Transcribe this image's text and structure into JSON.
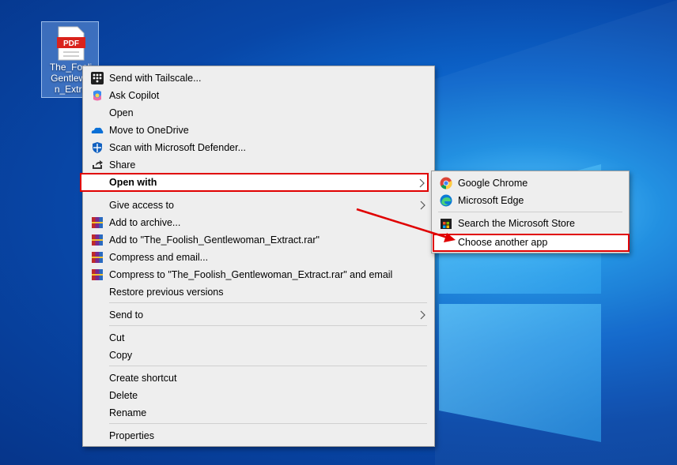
{
  "desktop": {
    "file": {
      "name_lines": [
        "The_Fooli",
        "Gentlewo",
        "n_Extra"
      ],
      "badge": "PDF"
    }
  },
  "context_menu": {
    "items": [
      {
        "label": "Send with Tailscale...",
        "icon": "tailscale-icon"
      },
      {
        "label": "Ask Copilot",
        "icon": "copilot-icon"
      },
      {
        "label": "Open"
      },
      {
        "label": "Move to OneDrive",
        "icon": "onedrive-icon"
      },
      {
        "label": "Scan with Microsoft Defender...",
        "icon": "defender-icon"
      },
      {
        "label": "Share",
        "icon": "share-icon"
      },
      {
        "label": "Open with",
        "submenu": true
      },
      {
        "label": "Give access to",
        "submenu": true
      },
      {
        "label": "Add to archive...",
        "icon": "winrar-icon"
      },
      {
        "label": "Add to \"The_Foolish_Gentlewoman_Extract.rar\"",
        "icon": "winrar-icon"
      },
      {
        "label": "Compress and email...",
        "icon": "winrar-icon"
      },
      {
        "label": "Compress to \"The_Foolish_Gentlewoman_Extract.rar\" and email",
        "icon": "winrar-icon"
      },
      {
        "label": "Restore previous versions"
      },
      {
        "label": "Send to",
        "submenu": true
      },
      {
        "label": "Cut"
      },
      {
        "label": "Copy"
      },
      {
        "label": "Create shortcut"
      },
      {
        "label": "Delete"
      },
      {
        "label": "Rename"
      },
      {
        "label": "Properties"
      }
    ]
  },
  "open_with_submenu": {
    "items": [
      {
        "label": "Google Chrome",
        "icon": "chrome-icon"
      },
      {
        "label": "Microsoft Edge",
        "icon": "edge-icon"
      },
      {
        "label": "Search the Microsoft Store",
        "icon": "store-icon"
      },
      {
        "label": "Choose another app"
      }
    ]
  },
  "colors": {
    "highlight": "#e00000",
    "desktop_accent": "#0c63c9"
  }
}
